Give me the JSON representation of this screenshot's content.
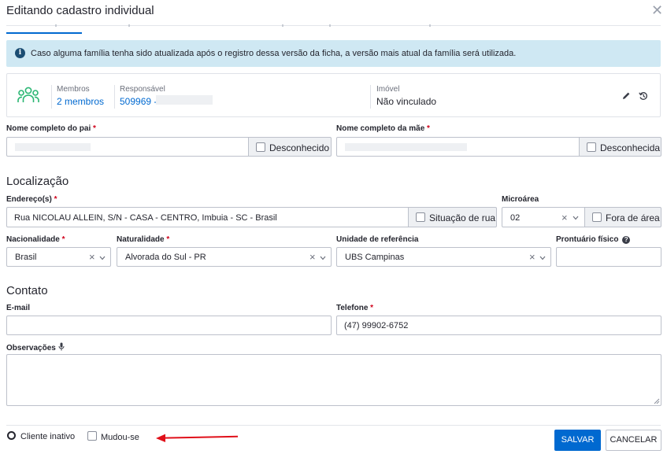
{
  "modal": {
    "title": "Editando cadastro individual",
    "close_icon": "close-icon"
  },
  "alert": {
    "icon": "info-icon",
    "icon_glyph": "i",
    "text": "Caso alguma família tenha sido atualizada após o registro dessa versão da ficha, a versão mais atual da família será utilizada."
  },
  "family": {
    "members_label": "Membros",
    "members_value": "2 membros",
    "responsible_label": "Responsável",
    "responsible_value": "509969 -",
    "property_label": "Imóvel",
    "property_value": "Não vinculado"
  },
  "parents": {
    "father_label": "Nome completo do pai",
    "father_unknown": "Desconhecido",
    "mother_label": "Nome completo da mãe",
    "mother_unknown": "Desconhecida"
  },
  "location": {
    "section_title": "Localização",
    "address_label": "Endereço(s)",
    "address_value": "Rua NICOLAU ALLEIN, S/N - CASA - CENTRO, Imbuia - SC - Brasil",
    "street_situation": "Situação de rua",
    "microarea_label": "Microárea",
    "microarea_value": "02",
    "out_of_area": "Fora de área",
    "nationality_label": "Nacionalidade",
    "nationality_value": "Brasil",
    "birthplace_label": "Naturalidade",
    "birthplace_value": "Alvorada do Sul - PR",
    "reference_unit_label": "Unidade de referência",
    "reference_unit_value": "UBS Campinas",
    "record_label": "Prontuário físico",
    "required_mark": "*",
    "clear_glyph": "×",
    "help_glyph": "?"
  },
  "contact": {
    "section_title": "Contato",
    "email_label": "E-mail",
    "email_value": "",
    "phone_label": "Telefone",
    "phone_value": "(47) 99902-6752",
    "notes_label": "Observações"
  },
  "footer": {
    "inactive_label": "Cliente inativo",
    "moved_label": "Mudou-se",
    "save_label": "SALVAR",
    "cancel_label": "CANCELAR",
    "arrow_color": "#e0101a"
  },
  "colors": {
    "primary": "#0069d0",
    "alert_bg": "#cfe8f3",
    "required": "#d0021b",
    "icon_green": "#2bb673"
  }
}
